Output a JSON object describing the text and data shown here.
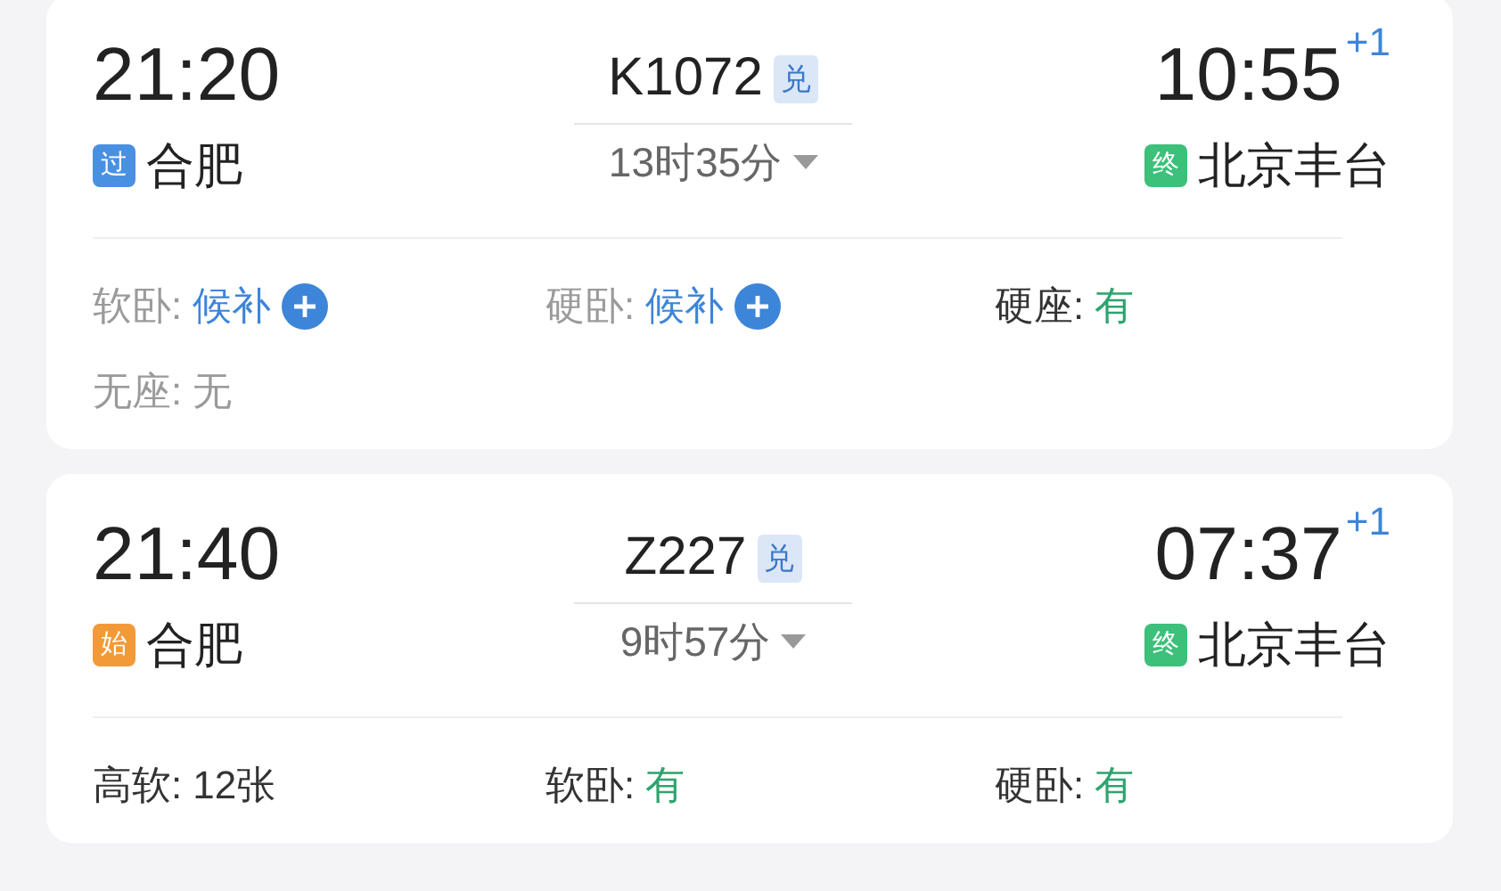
{
  "trains": [
    {
      "depart_time": "21:20",
      "depart_station": {
        "badge": "过",
        "kind": "pass",
        "name": "合肥"
      },
      "train_number": "K1072",
      "tag": "兑",
      "duration": "13时35分",
      "arrive_time": "10:55",
      "day_offset": "+1",
      "arrive_station": {
        "badge": "终",
        "kind": "end",
        "name": "北京丰台"
      },
      "seats": [
        {
          "label": "软卧:",
          "value": "候补",
          "kind": "waitlist"
        },
        {
          "label": "硬卧:",
          "value": "候补",
          "kind": "waitlist"
        },
        {
          "label": "硬座:",
          "value": "有",
          "kind": "available"
        },
        {
          "label": "无座:",
          "value": "无",
          "kind": "none"
        }
      ]
    },
    {
      "depart_time": "21:40",
      "depart_station": {
        "badge": "始",
        "kind": "start",
        "name": "合肥"
      },
      "train_number": "Z227",
      "tag": "兑",
      "duration": "9时57分",
      "arrive_time": "07:37",
      "day_offset": "+1",
      "arrive_station": {
        "badge": "终",
        "kind": "end",
        "name": "北京丰台"
      },
      "seats": [
        {
          "label": "高软:",
          "value": "12张",
          "kind": "count"
        },
        {
          "label": "软卧:",
          "value": "有",
          "kind": "available"
        },
        {
          "label": "硬卧:",
          "value": "有",
          "kind": "available"
        }
      ]
    }
  ]
}
